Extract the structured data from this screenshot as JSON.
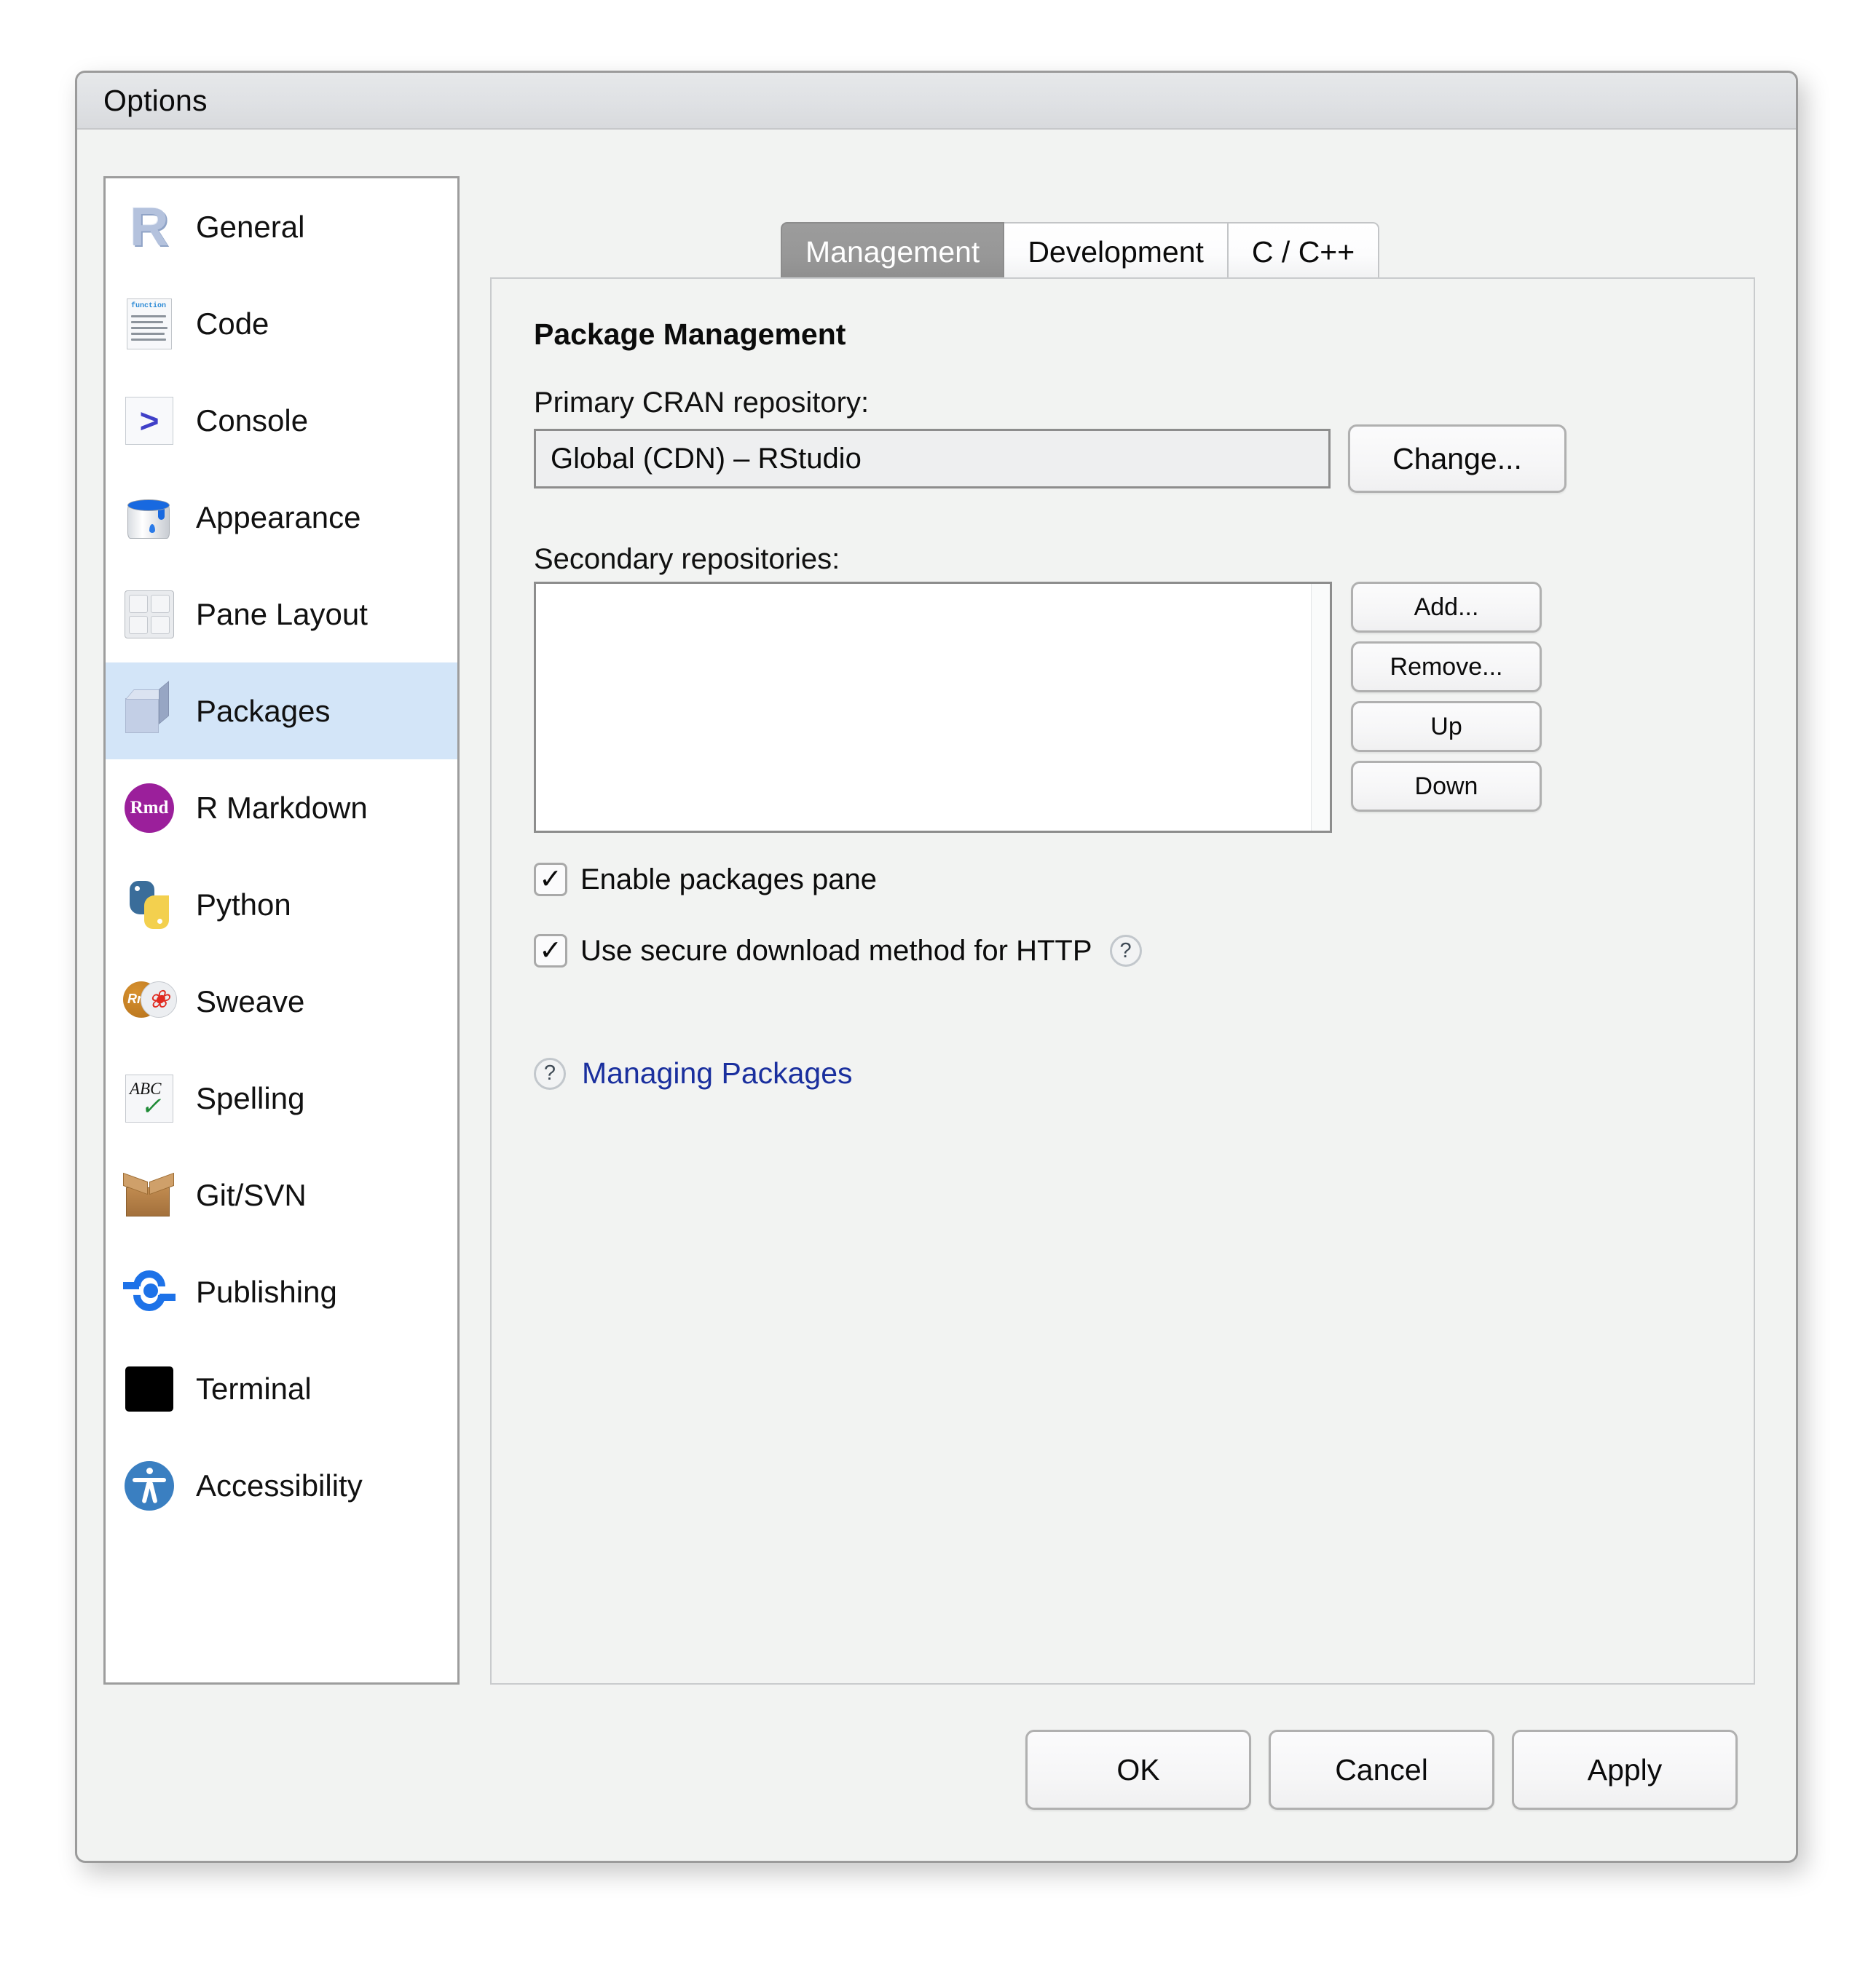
{
  "window": {
    "title": "Options"
  },
  "sidebar": {
    "items": [
      {
        "label": "General",
        "icon": "r-logo-icon",
        "selected": false
      },
      {
        "label": "Code",
        "icon": "code-document-icon",
        "selected": false
      },
      {
        "label": "Console",
        "icon": "console-prompt-icon",
        "selected": false
      },
      {
        "label": "Appearance",
        "icon": "paint-can-icon",
        "selected": false
      },
      {
        "label": "Pane Layout",
        "icon": "pane-grid-icon",
        "selected": false
      },
      {
        "label": "Packages",
        "icon": "package-box-icon",
        "selected": true
      },
      {
        "label": "R Markdown",
        "icon": "rmd-badge-icon",
        "selected": false
      },
      {
        "label": "Python",
        "icon": "python-logo-icon",
        "selected": false
      },
      {
        "label": "Sweave",
        "icon": "sweave-rnw-pdf-icon",
        "selected": false
      },
      {
        "label": "Spelling",
        "icon": "abc-check-icon",
        "selected": false
      },
      {
        "label": "Git/SVN",
        "icon": "cardboard-box-icon",
        "selected": false
      },
      {
        "label": "Publishing",
        "icon": "publish-sync-icon",
        "selected": false
      },
      {
        "label": "Terminal",
        "icon": "terminal-black-icon",
        "selected": false
      },
      {
        "label": "Accessibility",
        "icon": "accessibility-icon",
        "selected": false
      }
    ]
  },
  "tabs": [
    {
      "label": "Management",
      "active": true
    },
    {
      "label": "Development",
      "active": false
    },
    {
      "label": "C / C++",
      "active": false
    }
  ],
  "management": {
    "section_title": "Package Management",
    "primary_label": "Primary CRAN repository:",
    "primary_value": "Global (CDN) – RStudio",
    "change_button": "Change...",
    "secondary_label": "Secondary repositories:",
    "secondary_items": [],
    "list_buttons": {
      "add": "Add...",
      "remove": "Remove...",
      "up": "Up",
      "down": "Down"
    },
    "checkboxes": [
      {
        "label": "Enable packages pane",
        "checked": true,
        "check_glyph": "✓",
        "help": false
      },
      {
        "label": "Use secure download method for HTTP",
        "checked": true,
        "check_glyph": "✓",
        "help": true
      }
    ],
    "help_glyph": "?",
    "help_link": "Managing Packages"
  },
  "footer": {
    "ok": "OK",
    "cancel": "Cancel",
    "apply": "Apply"
  },
  "colors": {
    "selection": "#d3e5f8",
    "active_tab": "#979797",
    "link": "#1a2f9e",
    "dialog_bg": "#f2f3f2"
  }
}
